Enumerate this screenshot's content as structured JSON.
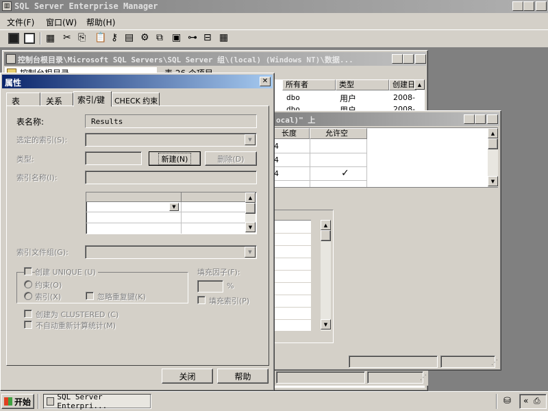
{
  "app": {
    "title": "SQL Server Enterprise Manager",
    "menu": [
      "文件(F)",
      "窗口(W)",
      "帮助(H)"
    ]
  },
  "console_window": {
    "title": "控制台根目录\\Microsoft SQL Servers\\SQL Server 组\\(local) (Windows NT)\\数据...",
    "tree_label": "控制台根目录",
    "list_caption": "表    26 个项目",
    "columns": [
      "所有者",
      "类型",
      "创建日"
    ],
    "rows": [
      {
        "owner": "dbo",
        "type": "用户",
        "created": "2008-"
      },
      {
        "owner": "dbo",
        "type": "用户",
        "created": "2008-"
      }
    ]
  },
  "design_window": {
    "title": "ocal)\" 上",
    "columns": [
      "长度",
      "允许空"
    ],
    "rows": [
      {
        "length": "4",
        "nullable": ""
      },
      {
        "length": "4",
        "nullable": ""
      },
      {
        "length": "4",
        "nullable": "✓"
      }
    ]
  },
  "dialog": {
    "title": "属性",
    "tabs": [
      "表",
      "关系",
      "索引/键",
      "CHECK 约束"
    ],
    "active_tab": "索引/键",
    "table_name_label": "表名称:",
    "table_name_value": "Results",
    "selected_index_label": "选定的索引(S):",
    "type_label": "类型:",
    "new_button": "新建(N)",
    "delete_button": "删除(D)",
    "index_name_label": "索引名称(I):",
    "filegroup_label": "索引文件组(G):",
    "create_unique_label": "创建 UNIQUE (U)",
    "constraint_label": "约束(O)",
    "index_label": "索引(X)",
    "ignore_dup_label": "忽略重复键(K)",
    "fill_factor_label": "填充因子(F):",
    "fill_factor_unit": "%",
    "pad_index_label": "填充索引(P)",
    "clustered_label": "创建为 CLUSTERED (C)",
    "no_recompute_label": "不自动重新计算统计(M)",
    "close_button": "关闭",
    "help_button": "帮助"
  },
  "taskbar": {
    "start_label": "开始",
    "task_label": "SQL Server Enterpri..."
  }
}
